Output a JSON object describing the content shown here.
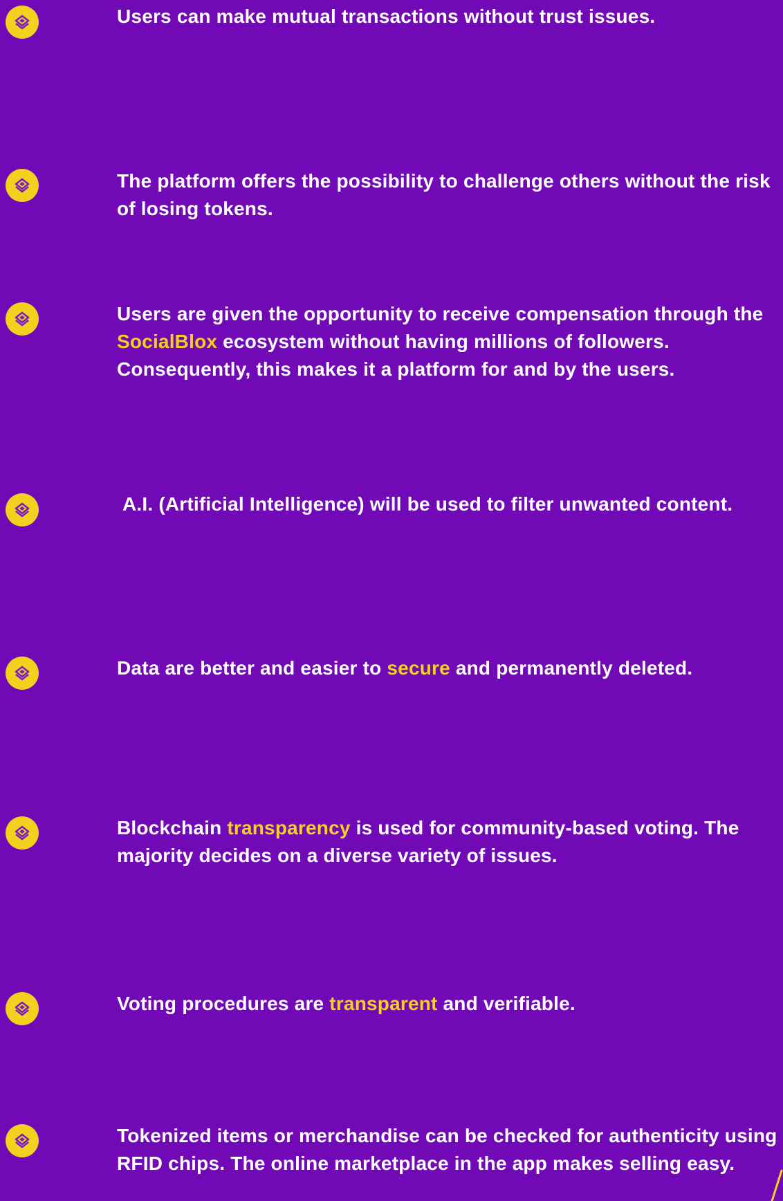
{
  "colors": {
    "background": "#7209b7",
    "accent": "#f2d21c",
    "text": "#ffffff",
    "icon_stroke": "#7a1cc4"
  },
  "bullet_icon": "socialblox-logo-icon",
  "features": [
    {
      "before": "Users can make mutual transactions without trust issues.",
      "highlight": "",
      "after": ""
    },
    {
      "before": "The platform offers the possibility to challenge others without the risk of losing tokens.",
      "highlight": "",
      "after": ""
    },
    {
      "before": "Users are given the opportunity to receive compensation through the ",
      "highlight": "SocialBlox",
      "after": " ecosystem without having millions of followers. Consequently, this makes it a platform for and by the users."
    },
    {
      "before": " A.I. (Artificial Intelligence) will be used to filter unwanted content.",
      "highlight": "",
      "after": ""
    },
    {
      "before": "Data are better and easier to ",
      "highlight": "secure",
      "after": " and permanently deleted."
    },
    {
      "before": "Blockchain ",
      "highlight": "transparency",
      "after": " is used for community-based voting. The majority decides on a diverse variety of issues."
    },
    {
      "before": "Voting procedures are ",
      "highlight": "transparent",
      "after": " and verifiable."
    },
    {
      "before": "Tokenized items or merchandise can be checked for authenticity using RFID chips. The online marketplace in the app makes selling easy.",
      "highlight": "",
      "after": ""
    }
  ]
}
